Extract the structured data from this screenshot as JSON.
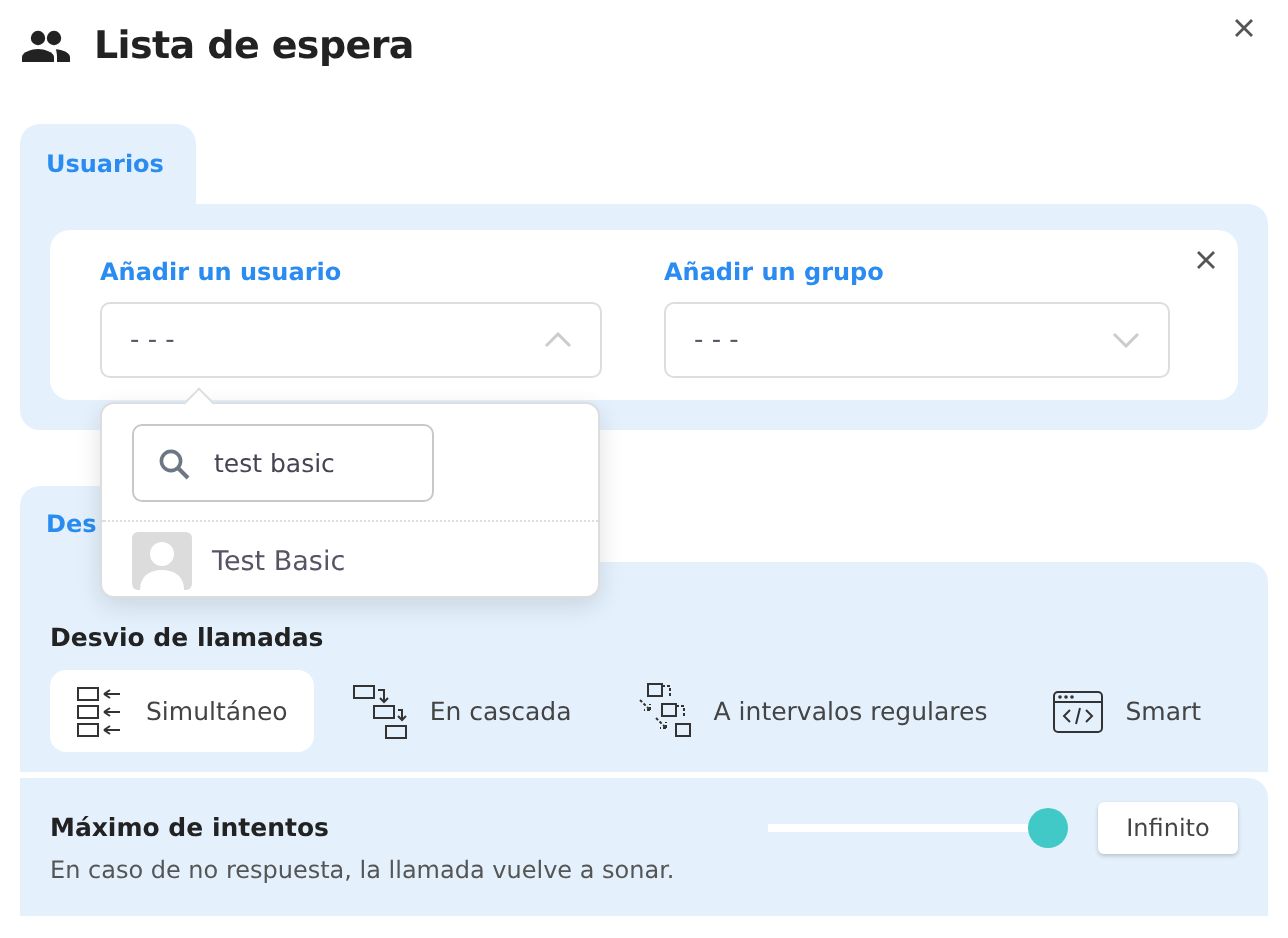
{
  "window": {
    "title": "Lista de espera"
  },
  "sections": [
    {
      "tab": {
        "label": "Usuarios",
        "selected": true
      },
      "fields": [
        {
          "label": "Añadir un usuario",
          "value": "- - -",
          "expanded": true
        },
        {
          "label": "Añadir un grupo",
          "value": "- - -",
          "expanded": false
        }
      ],
      "dropdown": {
        "search": {
          "value": "test basic"
        },
        "results": [
          {
            "label": "Test Basic"
          }
        ]
      }
    },
    {
      "tab": {
        "label": "Des",
        "selected": true
      },
      "forwarding": {
        "heading": "Desvio de llamadas",
        "options": [
          {
            "label": "Simultáneo",
            "kind": "simultaneous",
            "selected": true
          },
          {
            "label": "En cascada",
            "kind": "cascade",
            "selected": false
          },
          {
            "label": "A intervalos regulares",
            "kind": "intervals",
            "selected": false
          },
          {
            "label": "Smart",
            "kind": "smart",
            "selected": false
          }
        ]
      },
      "attempts": {
        "heading": "Máximo de intentos",
        "description": "En caso de no respuesta, la llamada vuelve a sonar.",
        "level": 1,
        "value": "Infinito"
      }
    }
  ]
}
